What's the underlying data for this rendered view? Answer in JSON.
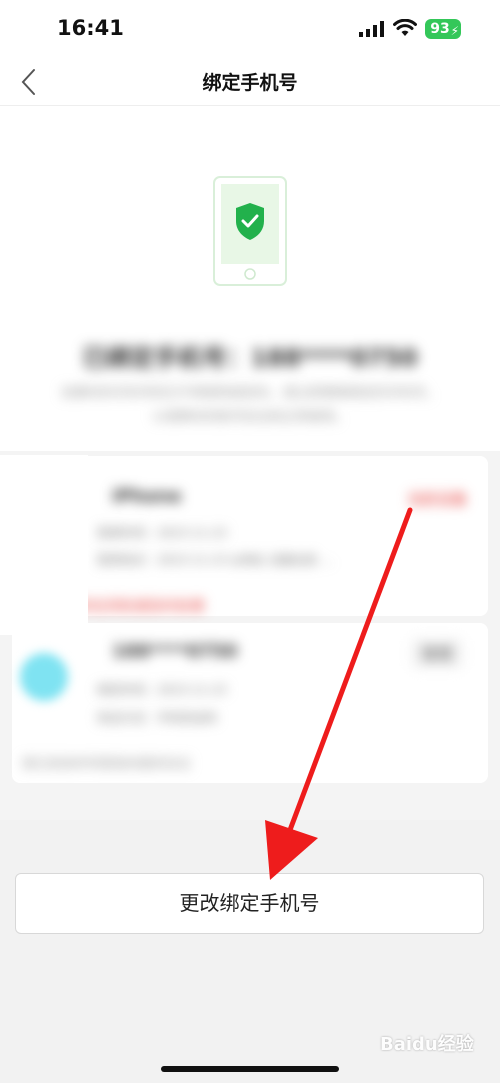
{
  "status_bar": {
    "time": "16:41",
    "battery": "93"
  },
  "nav": {
    "title": "绑定手机号"
  },
  "bound": {
    "title": "已绑定手机号：188****0750",
    "desc_line1": "如果你的手机号码已不再使用或丢失，请立即更换绑定的手机号，",
    "desc_line2": "以保障你的账号安全和正常使用。"
  },
  "devices": {
    "card1_name": "iPhone",
    "card1_tag": "当前设备",
    "card1_line1": "登录时间：2023-11-23",
    "card1_line2": "登录地点：2023-11-23 ip地址 设备信息 ...",
    "warning": "当前设备存在风险请及时处理",
    "card2_name": "188****0750",
    "card2_action": "管理",
    "card2_line1": "绑定时间：2023-11-23",
    "card2_line2": "验证方式：手机验证码",
    "check_text": "我已阅读并同意相关服务协议"
  },
  "actions": {
    "change_label": "更改绑定手机号"
  },
  "watermark": {
    "text": "Baidu经验"
  },
  "colors": {
    "shield": "#22b14c",
    "accent_red": "#e53935",
    "battery": "#34c759"
  }
}
